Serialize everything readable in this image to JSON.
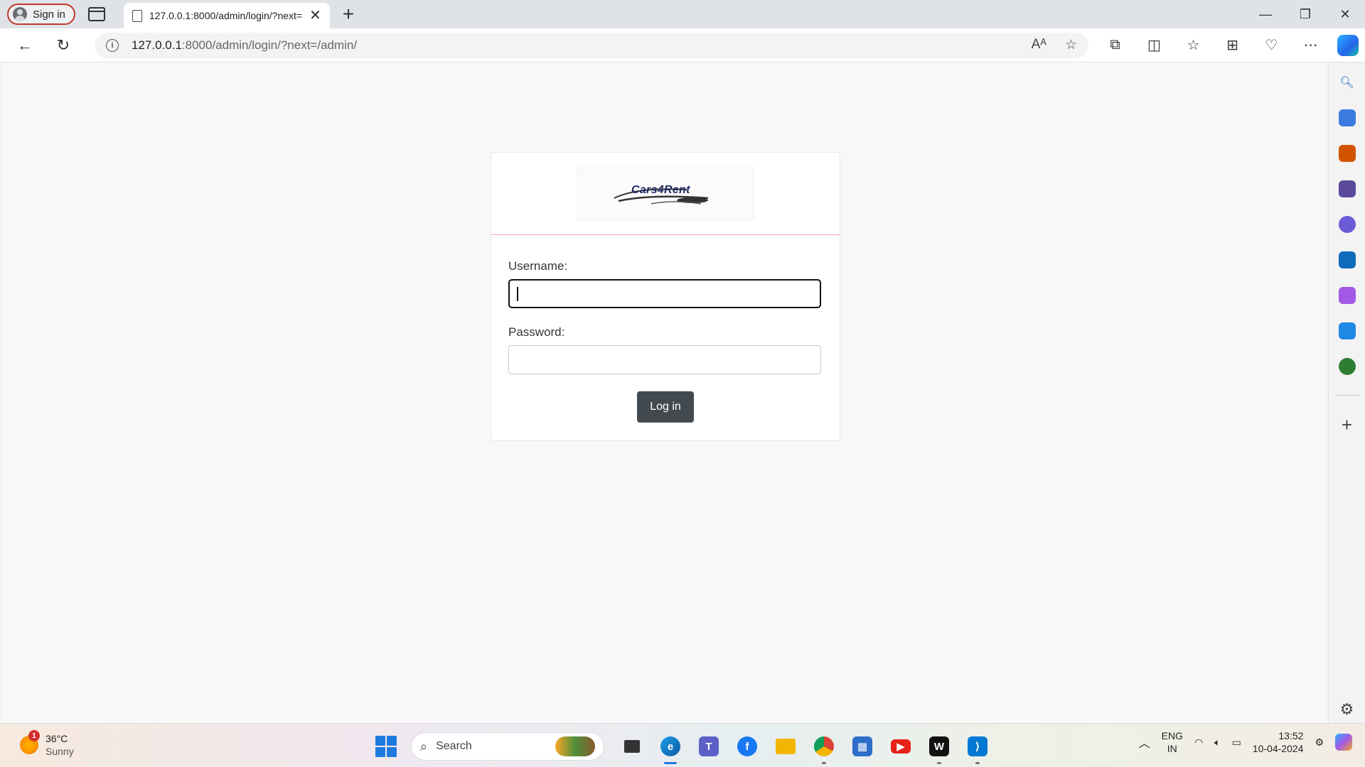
{
  "browser": {
    "profile_label": "Sign in",
    "tab_title": "127.0.0.1:8000/admin/login/?next=/admin/",
    "url_host": "127.0.0.1",
    "url_rest": ":8000/admin/login/?next=/admin/"
  },
  "page": {
    "logo_text": "Cars4Rent",
    "username_label": "Username:",
    "username_value": "",
    "password_label": "Password:",
    "password_value": "",
    "submit_label": "Log in"
  },
  "taskbar": {
    "weather_temp": "36°C",
    "weather_desc": "Sunny",
    "weather_badge": "1",
    "search_placeholder": "Search",
    "lang_1": "ENG",
    "lang_2": "IN",
    "time": "13:52",
    "date": "10-04-2024"
  },
  "colors": {
    "header_rule": "#f3a3a8",
    "button_bg": "#424a4f",
    "profile_border": "#c0392b"
  }
}
